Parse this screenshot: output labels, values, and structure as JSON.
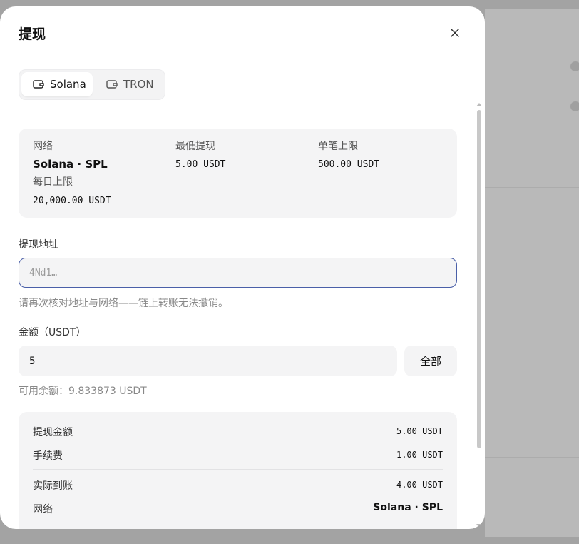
{
  "dialog": {
    "title": "提现"
  },
  "tabs": [
    {
      "label": "Solana",
      "active": true,
      "icon": "wallet-icon"
    },
    {
      "label": "TRON",
      "active": false,
      "icon": "wallet-icon"
    }
  ],
  "info": {
    "network_label": "网络",
    "network_value": "Solana · SPL",
    "min_label": "最低提现",
    "min_value": "5.00 USDT",
    "max_single_label": "单笔上限",
    "max_single_value": "500.00 USDT",
    "daily_label": "每日上限",
    "daily_value": "20,000.00 USDT"
  },
  "address": {
    "label": "提现地址",
    "placeholder": "4Nd1…",
    "hint": "请再次核对地址与网络——链上转账无法撤销。"
  },
  "amount": {
    "label": "金额（USDT）",
    "value": "5",
    "all_button": "全部",
    "balance": "可用余额：9.833873 USDT"
  },
  "summary": {
    "amount_label": "提现金额",
    "amount_value": "5.00 USDT",
    "fee_label": "手续费",
    "fee_value": "-1.00 USDT",
    "received_label": "实际到账",
    "received_value": "4.00 USDT",
    "network_label": "网络",
    "network_value": "Solana · SPL"
  },
  "colors": {
    "focus_border": "#4a5fa8",
    "card_bg": "#f4f4f5",
    "overlay": "#a3a3a3"
  }
}
